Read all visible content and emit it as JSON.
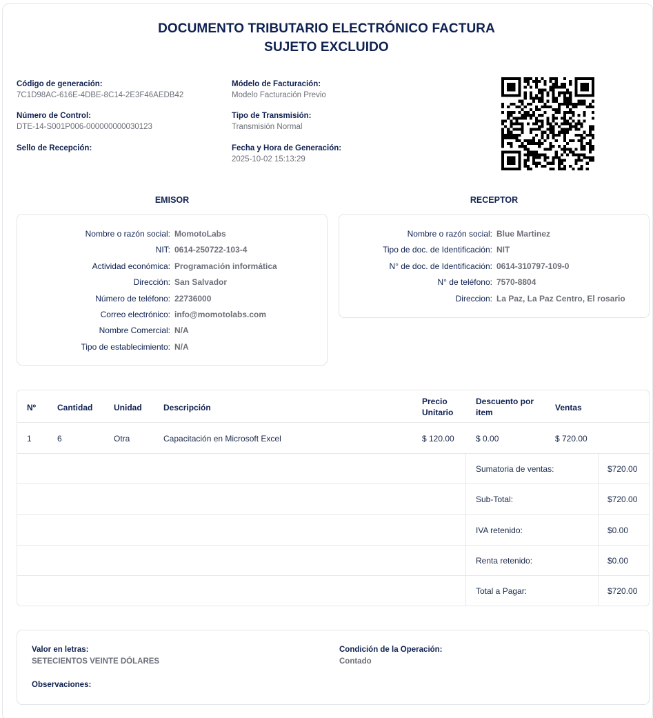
{
  "document": {
    "title_line1": "DOCUMENTO TRIBUTARIO ELECTRÓNICO FACTURA",
    "title_line2": "SUJETO EXCLUIDO"
  },
  "meta": {
    "codigo_label": "Código de generación:",
    "codigo_value": "7C1D98AC-616E-4DBE-8C14-2E3F46AEDB42",
    "control_label": "Número de Control:",
    "control_value": "DTE-14-S001P006-000000000030123",
    "sello_label": "Sello de Recepción:",
    "modelo_label": "Módelo de Facturación:",
    "modelo_value": "Modelo Facturación Previo",
    "transmision_label": "Tipo de Transmisión:",
    "transmision_value": "Transmisión Normal",
    "fecha_label": "Fecha y Hora de Generación:",
    "fecha_value": "2025-10-02 15:13:29"
  },
  "emisor": {
    "heading": "EMISOR",
    "rows": [
      {
        "k": "Nombre o razón social:",
        "v": "MomotoLabs"
      },
      {
        "k": "NIT:",
        "v": "0614-250722-103-4"
      },
      {
        "k": "Actividad económica:",
        "v": "Programación informática"
      },
      {
        "k": "Dirección:",
        "v": "San Salvador"
      },
      {
        "k": "Número de teléfono:",
        "v": "22736000"
      },
      {
        "k": "Correo electrónico:",
        "v": "info@momotolabs.com"
      },
      {
        "k": "Nombre Comercial:",
        "v": "N/A"
      },
      {
        "k": "Tipo de establecimiento:",
        "v": "N/A"
      }
    ]
  },
  "receptor": {
    "heading": "RECEPTOR",
    "rows": [
      {
        "k": "Nombre o razón social:",
        "v": "Blue Martinez"
      },
      {
        "k": "Tipo de doc. de Identificación:",
        "v": "NIT"
      },
      {
        "k": "N° de doc. de Identificación:",
        "v": "0614-310797-109-0"
      },
      {
        "k": "N° de teléfono:",
        "v": "7570-8804"
      },
      {
        "k": "Direccion:",
        "v": "La Paz, La Paz Centro, El rosario"
      }
    ]
  },
  "table": {
    "headers": {
      "num": "Nº",
      "cantidad": "Cantidad",
      "unidad": "Unidad",
      "descripcion": "Descripción",
      "precio_1": "Precio",
      "precio_2": "Unitario",
      "descuento_1": "Descuento por",
      "descuento_2": "item",
      "ventas": "Ventas"
    },
    "rows": [
      {
        "num": "1",
        "cantidad": "6",
        "unidad": "Otra",
        "descripcion": "Capacitación en Microsoft Excel",
        "precio": "$ 120.00",
        "descuento": "$ 0.00",
        "ventas": "$ 720.00"
      }
    ],
    "summary": [
      {
        "label": "Sumatoria de ventas:",
        "value": "$720.00"
      },
      {
        "label": "Sub-Total:",
        "value": "$720.00"
      },
      {
        "label": "IVA retenido:",
        "value": "$0.00"
      },
      {
        "label": "Renta retenido:",
        "value": "$0.00"
      },
      {
        "label": "Total a Pagar:",
        "value": "$720.00"
      }
    ]
  },
  "footer": {
    "valor_label": "Valor en letras:",
    "valor_value": "SETECIENTOS VEINTE DÓLARES",
    "condicion_label": "Condición de la Operación:",
    "condicion_value": "Contado",
    "observaciones_label": "Observaciones:"
  }
}
